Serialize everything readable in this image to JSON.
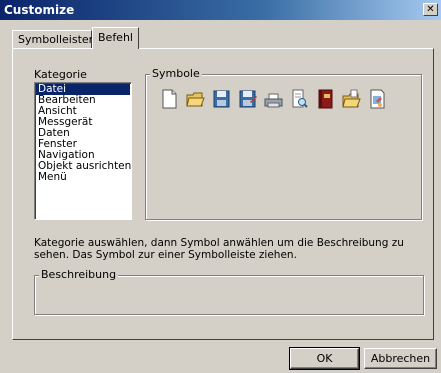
{
  "window": {
    "title": "Customize",
    "close_glyph": "✕"
  },
  "tabs": [
    {
      "label": "Symbolleisten",
      "active": false
    },
    {
      "label": "Befehl",
      "active": true
    }
  ],
  "category": {
    "label": "Kategorie",
    "items": [
      "Datei",
      "Bearbeiten",
      "Ansicht",
      "Messgerät",
      "Daten",
      "Fenster",
      "Navigation",
      "Objekt ausrichten",
      "Menü"
    ],
    "selected": "Datei"
  },
  "symbols": {
    "label": "Symbole",
    "icons": [
      "new-document-icon",
      "open-folder-icon",
      "save-icon",
      "save-as-icon",
      "print-icon",
      "print-preview-icon",
      "book-icon",
      "open-project-folder-icon",
      "export-icon"
    ]
  },
  "instructions": "Kategorie auswählen, dann Symbol anwählen um die Beschreibung zu sehen. Das Symbol zur einer Symbolleiste ziehen.",
  "description": {
    "label": "Beschreibung"
  },
  "buttons": {
    "ok": "OK",
    "cancel": "Abbrechen"
  },
  "colors": {
    "titlebar": "#0a246a",
    "selection": "#0a246a",
    "face": "#d4d0c8"
  }
}
